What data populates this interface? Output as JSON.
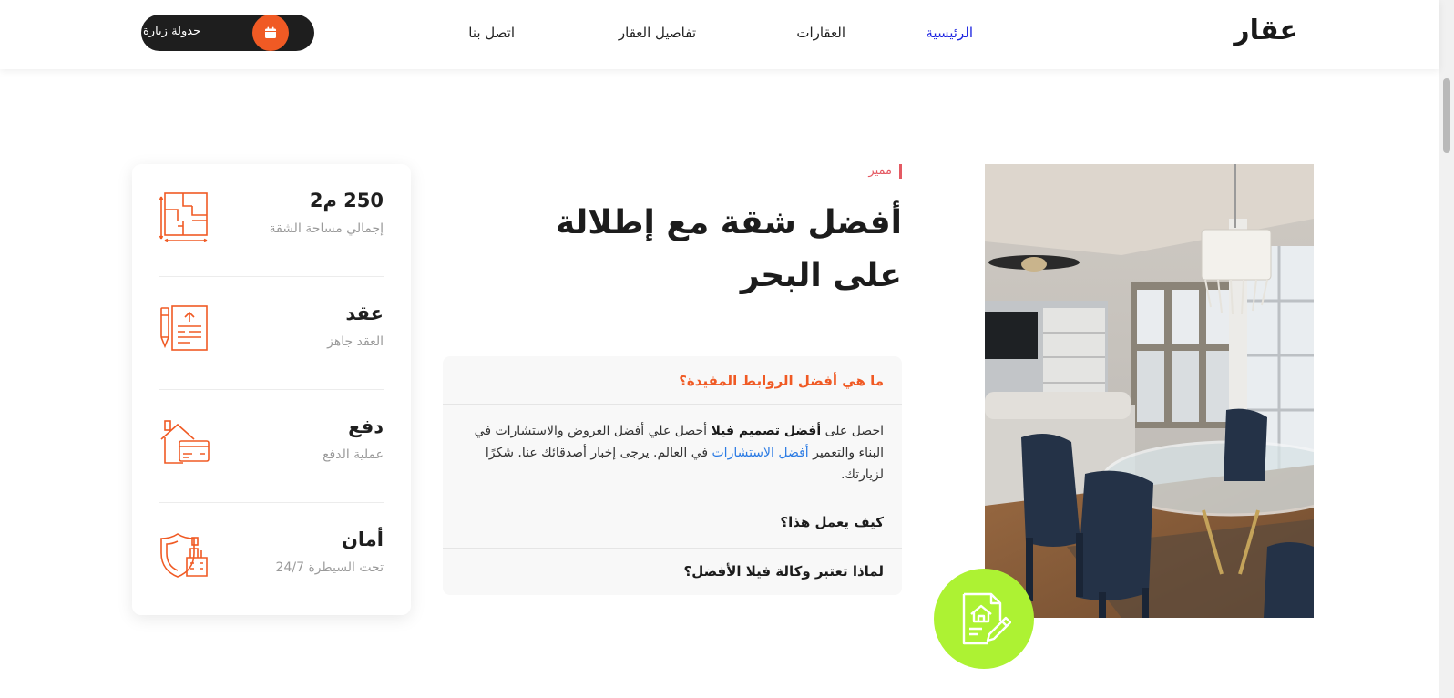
{
  "header": {
    "logo": "عقار",
    "nav": [
      {
        "label": "الرئيسية",
        "active": true
      },
      {
        "label": "العقارات",
        "active": false
      },
      {
        "label": "تفاصيل العقار",
        "active": false
      },
      {
        "label": "اتصل بنا",
        "active": false
      }
    ],
    "schedule_button": "جدولة زيارة"
  },
  "features": [
    {
      "title": "250 م2",
      "subtitle": "إجمالي مساحة الشقة",
      "icon": "floor-plan-icon"
    },
    {
      "title": "عقد",
      "subtitle": "العقد جاهز",
      "icon": "contract-icon"
    },
    {
      "title": "دفع",
      "subtitle": "عملية الدفع",
      "icon": "payment-icon"
    },
    {
      "title": "أمان",
      "subtitle": "تحت السيطرة 24/7",
      "icon": "security-icon"
    }
  ],
  "main": {
    "tag": "مميز",
    "headline": "أفضل شقة مع إطلالة على البحر",
    "accordion": {
      "q1": "ما هي أفضل الروابط المفيدة؟",
      "a1_part1": "احصل على ",
      "a1_bold": "أفضل تصميم فيلا",
      "a1_part2": " أحصل علي أفضل العروض والاستشارات في البناء والتعمير ",
      "a1_link": "أفضل الاستشارات",
      "a1_part3": " في العالم. يرجى إخبار أصدقائك عنا. شكرًا لزيارتك.",
      "q2": "كيف يعمل هذا؟",
      "q3": "لماذا تعتبر وكالة فيلا الأفضل؟"
    }
  },
  "colors": {
    "accent": "#f05a24",
    "nav_active": "#1b22e0",
    "tag": "#e45a63",
    "badge": "#adf233",
    "link": "#2b7be4"
  }
}
